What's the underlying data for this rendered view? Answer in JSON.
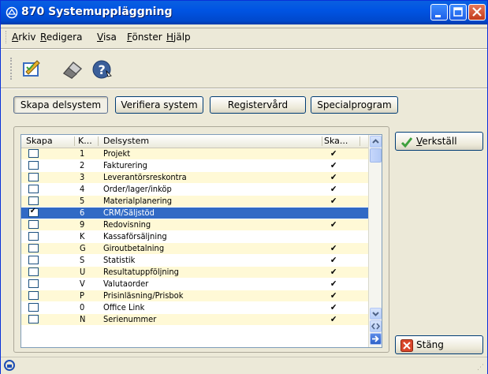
{
  "window": {
    "title": "870 Systemuppläggning"
  },
  "menu": [
    "Arkiv",
    "Redigera",
    "Visa",
    "Fönster",
    "Hjälp"
  ],
  "toolbar": {
    "icons": [
      "edit-document-icon",
      "eraser-icon",
      "help-icon"
    ]
  },
  "actions": [
    "Skapa delsystem",
    "Verifiera system",
    "Registervård",
    "Specialprogram"
  ],
  "table": {
    "headers": [
      "Skapa",
      "K...",
      "Delsystem",
      "Ska..."
    ],
    "rows": [
      {
        "skapa": false,
        "k": "1",
        "name": "Projekt",
        "ska": true
      },
      {
        "skapa": false,
        "k": "2",
        "name": "Fakturering",
        "ska": true
      },
      {
        "skapa": false,
        "k": "3",
        "name": "Leverantörsreskontra",
        "ska": true
      },
      {
        "skapa": false,
        "k": "4",
        "name": "Order/lager/inköp",
        "ska": true
      },
      {
        "skapa": false,
        "k": "5",
        "name": "Materialplanering",
        "ska": true
      },
      {
        "skapa": true,
        "k": "6",
        "name": "CRM/Säljstöd",
        "ska": false,
        "selected": true
      },
      {
        "skapa": false,
        "k": "9",
        "name": "Redovisning",
        "ska": true
      },
      {
        "skapa": false,
        "k": "K",
        "name": "Kassaförsäljning",
        "ska": false
      },
      {
        "skapa": false,
        "k": "G",
        "name": "Giroutbetalning",
        "ska": true
      },
      {
        "skapa": false,
        "k": "S",
        "name": "Statistik",
        "ska": true
      },
      {
        "skapa": false,
        "k": "U",
        "name": "Resultatuppföljning",
        "ska": true
      },
      {
        "skapa": false,
        "k": "V",
        "name": "Valutaorder",
        "ska": true
      },
      {
        "skapa": false,
        "k": "P",
        "name": "Prisinläsning/Prisbok",
        "ska": true
      },
      {
        "skapa": false,
        "k": "0",
        "name": "Office Link",
        "ska": true
      },
      {
        "skapa": false,
        "k": "N",
        "name": "Serienummer",
        "ska": true
      }
    ]
  },
  "side": {
    "apply": "Verkställ",
    "close": "Stäng"
  },
  "colors": {
    "title_bar": "#0054e3",
    "selection": "#316ac5",
    "alt_row": "#fff9d6"
  }
}
